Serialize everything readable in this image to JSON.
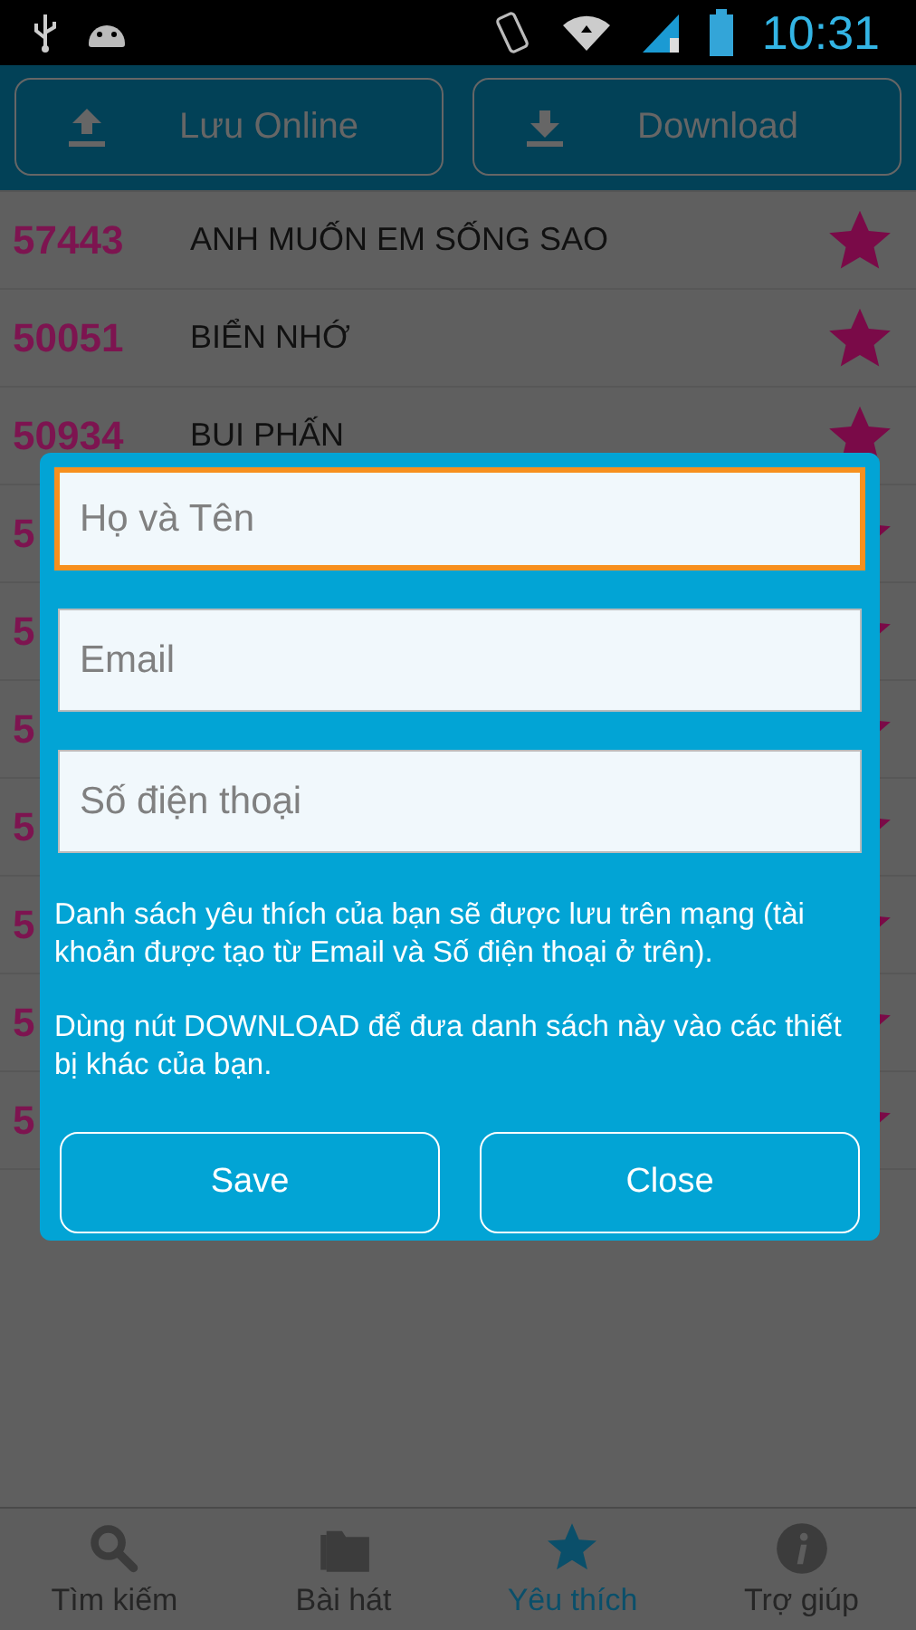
{
  "status_bar": {
    "time": "10:31"
  },
  "toolbar": {
    "buttons": [
      {
        "label": "Lưu Online"
      },
      {
        "label": "Download"
      }
    ]
  },
  "songs": [
    {
      "code": "57443",
      "title": "ANH MUỐN EM SỐNG SAO",
      "favorite": true
    },
    {
      "code": "50051",
      "title": "BIỂN NHỚ",
      "favorite": true
    },
    {
      "code": "50934",
      "title": "BUI PHẤN",
      "favorite": true
    },
    {
      "code": "5",
      "favorite": true
    },
    {
      "code": "5",
      "favorite": true
    },
    {
      "code": "5",
      "favorite": true
    },
    {
      "code": "5",
      "favorite": true
    },
    {
      "code": "5",
      "favorite": true
    },
    {
      "code": "5",
      "favorite": true
    },
    {
      "code": "5",
      "favorite": true
    }
  ],
  "dialog": {
    "fields": [
      {
        "placeholder": "Họ và Tên",
        "focused": true
      },
      {
        "placeholder": "Email",
        "focused": false
      },
      {
        "placeholder": "Số điện thoại",
        "focused": false
      }
    ],
    "notes": [
      "Danh sách yêu thích của bạn sẽ được lưu trên mạng (tài khoản được tạo từ Email và Số điện thoại ở trên).",
      "Dùng nút DOWNLOAD để đưa danh sách này vào các thiết bị khác của bạn."
    ],
    "buttons": [
      "Save",
      "Close"
    ]
  },
  "tabs": [
    {
      "label": "Tìm kiếm",
      "selected": false
    },
    {
      "label": "Bài hát",
      "selected": false
    },
    {
      "label": "Yêu thích",
      "selected": true
    },
    {
      "label": "Trợ giúp",
      "selected": false
    }
  ]
}
